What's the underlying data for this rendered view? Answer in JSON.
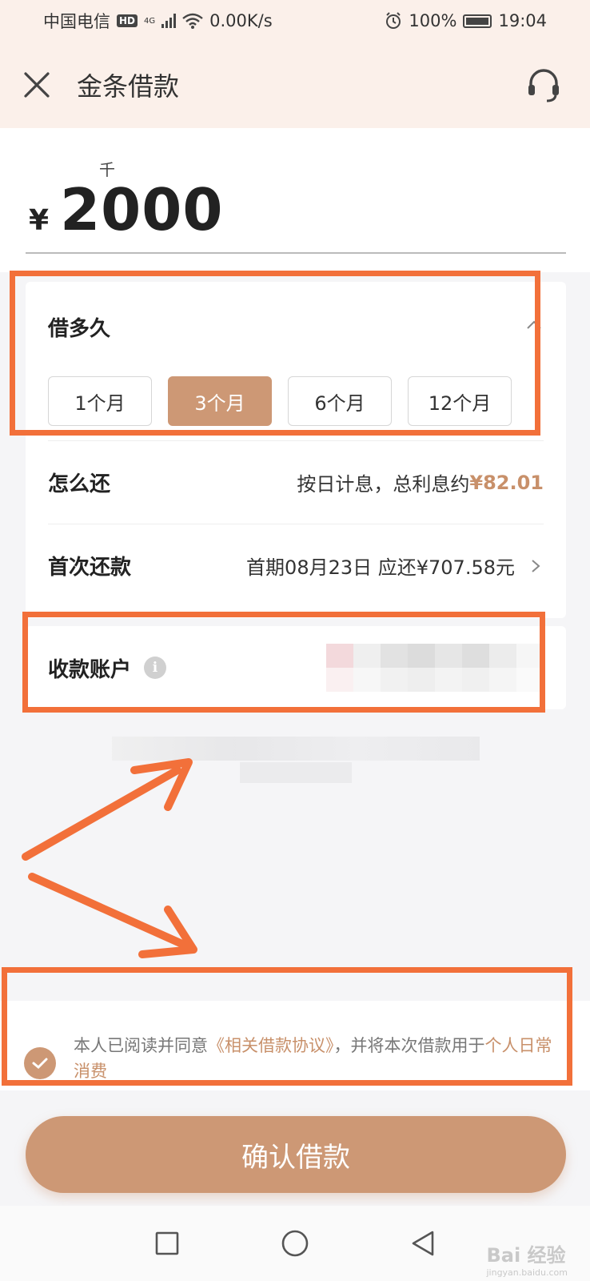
{
  "status_bar": {
    "carrier": "中国电信",
    "hd_badge": "HD",
    "network": "4G",
    "speed": "0.00K/s",
    "battery": "100%",
    "time": "19:04"
  },
  "header": {
    "title": "金条借款",
    "close_icon": "close-icon",
    "service_icon": "headset-icon"
  },
  "amount": {
    "unit_hint": "千",
    "currency": "¥",
    "value": "2000"
  },
  "duration": {
    "label": "借多久",
    "options": [
      {
        "label": "1个月",
        "selected": false
      },
      {
        "label": "3个月",
        "selected": true
      },
      {
        "label": "6个月",
        "selected": false
      },
      {
        "label": "12个月",
        "selected": false
      }
    ]
  },
  "repayment": {
    "label": "怎么还",
    "value_prefix": "按日计息，总利息约",
    "value_amount": "¥82.01"
  },
  "first_payment": {
    "label": "首次还款",
    "value": "首期08月23日 应还¥707.58元"
  },
  "account": {
    "label": "收款账户",
    "info_icon": "i"
  },
  "agreement": {
    "text_1": "本人已阅读并同意",
    "link_1": "《相关借款协议》",
    "text_2": "，并将本次借款用于",
    "link_2": "个人日常消费"
  },
  "confirm_button": {
    "label": "确认借款"
  },
  "watermark": {
    "brand": "Bai 经验",
    "url": "jingyan.baidu.com"
  },
  "colors": {
    "accent": "#cd9875",
    "highlight": "#f2703a",
    "header_bg": "#fbf0ea"
  }
}
